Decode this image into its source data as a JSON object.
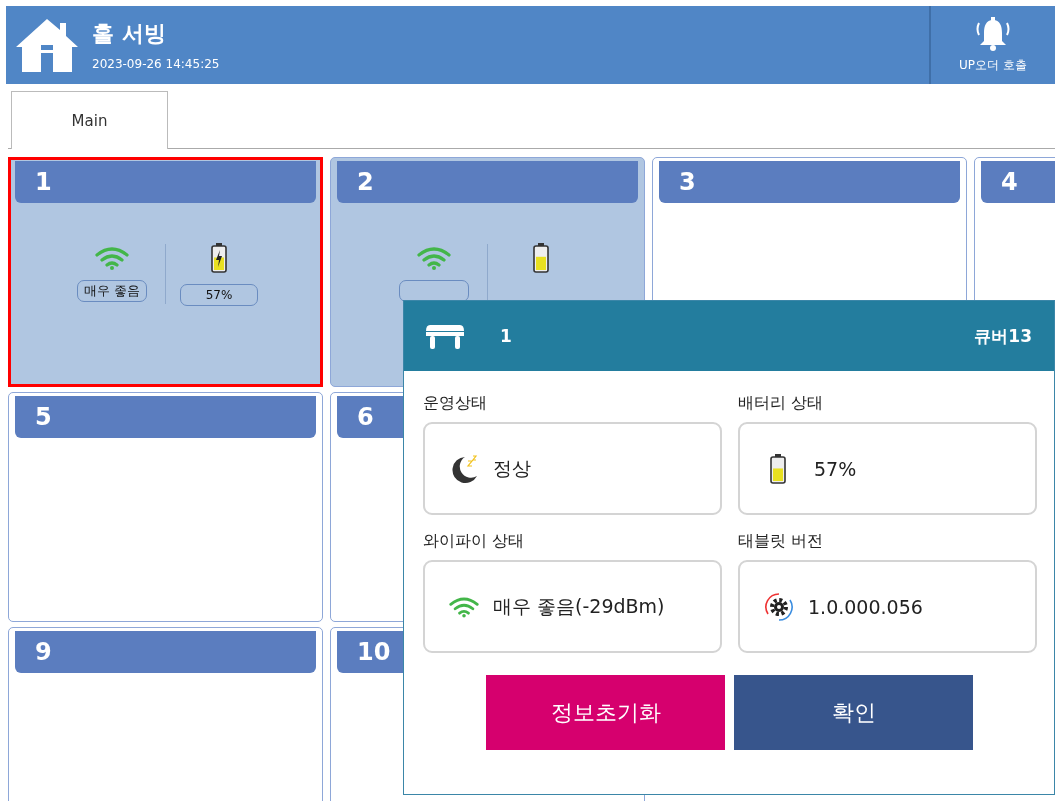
{
  "header": {
    "title": "홀 서빙",
    "datetime": "2023-09-26 14:45:25",
    "call_button": "UP오더 호출"
  },
  "tabs": [
    {
      "label": "Main",
      "selected": true
    }
  ],
  "table_rows": [
    [
      {
        "number": "1",
        "selected": true,
        "occupied": true,
        "wifi": "매우 좋음",
        "battery": {
          "level": 0.57,
          "charging": true,
          "reading": "57%"
        }
      },
      {
        "number": "2",
        "selected": false,
        "occupied": true,
        "battery": {
          "level": 0.6,
          "charging": false
        }
      },
      {
        "number": "3",
        "selected": false,
        "occupied": false
      },
      {
        "number": "4",
        "selected": false,
        "occupied": false
      }
    ],
    [
      {
        "number": "5",
        "selected": false,
        "occupied": false
      },
      {
        "number": "6",
        "selected": false,
        "occupied": false
      }
    ],
    [
      {
        "number": "9",
        "selected": false,
        "occupied": false
      },
      {
        "number": "10",
        "selected": false,
        "occupied": false
      }
    ]
  ],
  "popup": {
    "table": "1",
    "device": "큐버13",
    "fields": [
      {
        "kind": "status",
        "label": "운영상태",
        "value": "정상"
      },
      {
        "kind": "battery",
        "label": "배터리 상태",
        "value": "57%",
        "level": 0.57
      },
      {
        "kind": "wifi",
        "label": "와이파이 상태",
        "value": "매우 좋음(-29dBm)"
      },
      {
        "kind": "version",
        "label": "태블릿 버전",
        "value": "1.0.000.056"
      }
    ],
    "buttons": [
      {
        "kind": "reset",
        "label": "정보초기화"
      },
      {
        "kind": "confirm",
        "label": "확인"
      }
    ]
  }
}
